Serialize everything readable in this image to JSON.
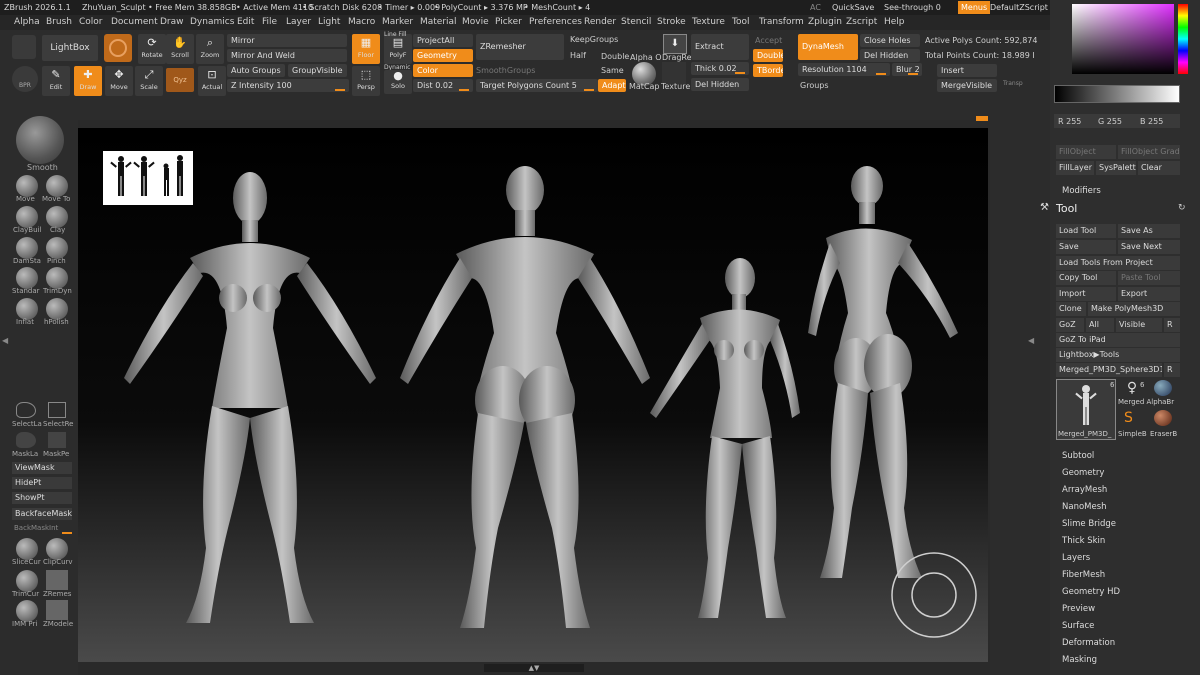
{
  "title_bar": {
    "app": "ZBrush 2026.1.1",
    "project": "ZhuYuan_Sculpt",
    "free_mem": "• Free Mem 38.858GB",
    "active_mem": "• Active Mem 4110",
    "scratch": "• Scratch Disk 6208",
    "timer": "• Timer ▸ 0.009",
    "poly": "• PolyCount ▸ 3.376 MP",
    "mesh": "• MeshCount ▸ 4",
    "ac": "AC",
    "quicksave": "QuickSave",
    "seethrough": "See-through  0",
    "menus": "Menus",
    "script": "DefaultZScript"
  },
  "menu": [
    "Alpha",
    "Brush",
    "Color",
    "Document",
    "Draw",
    "Dynamics",
    "Edit",
    "File",
    "Layer",
    "Light",
    "Macro",
    "Marker",
    "Material",
    "Movie",
    "Picker",
    "Preferences",
    "Render",
    "Stencil",
    "Stroke",
    "Texture",
    "Tool",
    "Transform",
    "Zplugin",
    "Zscript",
    "Help"
  ],
  "shelf": {
    "lightbox": "LightBox",
    "rotate": "Rotate",
    "scroll": "Scroll",
    "zoom": "Zoom",
    "edit": "Edit",
    "draw": "Draw",
    "move": "Move",
    "scale": "Scale",
    "actual": "Actual",
    "bpr": "BPR",
    "mirror": "Mirror",
    "mirror_weld": "Mirror And Weld",
    "auto_groups": "Auto Groups",
    "group_visible": "GroupVisible",
    "z_intensity": "Z Intensity 100",
    "floor": "Floor",
    "polyf": "PolyF",
    "line_fill": "Line Fill",
    "persp": "Persp",
    "dynamic": "Dynamic",
    "solo": "Solo",
    "project_all": "ProjectAll",
    "geometry": "Geometry",
    "color": "Color",
    "dist": "Dist 0.02",
    "adapt": "Adapt",
    "zremesher": "ZRemesher",
    "smooth_groups": "SmoothGroups",
    "target_polygons": "Target Polygons Count 5",
    "keep_groups": "KeepGroups",
    "half": "Half",
    "same": "Same",
    "double": "Double",
    "alpha_on": "Alpha O",
    "dragrect": "DragRe",
    "matcap": "MatCap",
    "texture": "Texture",
    "extract": "Extract",
    "thick": "Thick 0.02",
    "del_hidden": "Del Hidden",
    "accept": "Accept",
    "double2": "Double",
    "tborder": "TBorde",
    "dynamesh": "DynaMesh",
    "resolution": "Resolution 1104",
    "close_holes": "Close Holes",
    "del_hidden2": "Del Hidden",
    "blur": "Blur 2",
    "groups": "Groups",
    "active_polys": "Active Polys Count: 592,874",
    "total_points": "Total Points Count: 18.989 I",
    "insert": "Insert",
    "merge_visible": "MergeVisible",
    "transp": "Transp"
  },
  "left_brushes": [
    "Smooth",
    "Move",
    "Move To",
    "ClayBuil",
    "Clay",
    "DamSta",
    "Pinch",
    "Standar",
    "TrimDyn",
    "Inflat",
    "hPolish"
  ],
  "left_buttons": {
    "select_lasso": "SelectLa",
    "select_rect": "SelectRe",
    "mask_lasso": "MaskLa",
    "mask_pen": "MaskPe",
    "view_mask": "ViewMask",
    "hide_pt": "HidePt",
    "show_pt": "ShowPt",
    "backface_mask": "BackfaceMask",
    "backmask_int": "BackMaskInt",
    "slice_curve": "SliceCur",
    "clip_curve": "ClipCurv",
    "trim_curve": "TrimCur",
    "zremesh": "ZRemes",
    "imm_primitives": "IMM Pri",
    "zmodeler": "ZModele"
  },
  "color": {
    "r": "R 255",
    "g": "G 255",
    "b": "B 255",
    "fill_object": "FillObject",
    "fill_object_grad": "FillObject Grad",
    "fill_layer": "FillLayer",
    "sys_palette": "SysPalette",
    "clear": "Clear"
  },
  "tool_panel": {
    "modifiers": "Modifiers",
    "title": "Tool",
    "load_tool": "Load Tool",
    "save_as": "Save As",
    "save": "Save",
    "save_next": "Save Next",
    "load_from_project": "Load Tools From Project",
    "copy_tool": "Copy Tool",
    "paste_tool": "Paste Tool",
    "import": "Import",
    "export": "Export",
    "clone": "Clone",
    "make_polymesh": "Make PolyMesh3D",
    "goz": "GoZ",
    "all": "All",
    "visible": "Visible",
    "r": "R",
    "goz_ipad": "GoZ To iPad",
    "lightbox_tools": "Lightbox▶Tools",
    "current_tool": "Merged_PM3D_Sphere3D1_",
    "r2": "R",
    "thumb_count": "6",
    "thumb_count2": "6",
    "thumb_main": "Merged_PM3D_",
    "thumb_alpha": "Merged AlphaBr",
    "thumb_simple": "SimpleB",
    "thumb_eraser": "EraserB"
  },
  "subpalettes": [
    "Subtool",
    "Geometry",
    "ArrayMesh",
    "NanoMesh",
    "Slime Bridge",
    "Thick Skin",
    "Layers",
    "FiberMesh",
    "Geometry HD",
    "Preview",
    "Surface",
    "Deformation",
    "Masking"
  ]
}
